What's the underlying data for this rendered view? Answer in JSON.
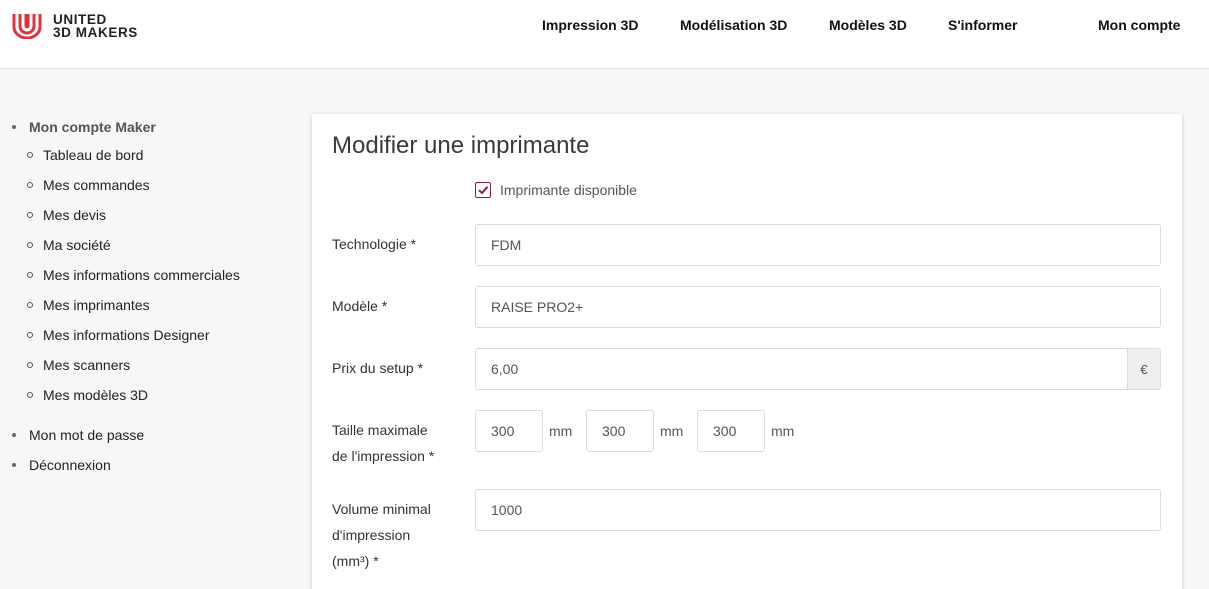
{
  "header": {
    "logo_line1": "UNITED",
    "logo_line2": "3D MAKERS",
    "brand_color": "#e2333d",
    "nav": {
      "impression": "Impression 3D",
      "modelisation": "Modélisation 3D",
      "modeles": "Modèles 3D",
      "informer": "S'informer",
      "compte": "Mon compte"
    }
  },
  "sidebar": {
    "maker": "Mon compte Maker",
    "items": [
      "Tableau de bord",
      "Mes commandes",
      "Mes devis",
      "Ma société",
      "Mes informations commerciales",
      "Mes imprimantes",
      "Mes informations Designer",
      "Mes scanners",
      "Mes modèles 3D"
    ],
    "password": "Mon mot de passe",
    "logout": "Déconnexion"
  },
  "form": {
    "title": "Modifier une imprimante",
    "available": {
      "label": "Imprimante disponible",
      "checked": true,
      "color": "#8a2238"
    },
    "technologie": {
      "label": "Technologie *",
      "value": "FDM"
    },
    "modele": {
      "label": "Modèle *",
      "value": "RAISE PRO2+"
    },
    "prix": {
      "label": "Prix du setup *",
      "value": "6,00",
      "addon": "€"
    },
    "taille": {
      "label_line1": "Taille maximale",
      "label_line2": "de l'impression *",
      "x": "300",
      "y": "300",
      "z": "300",
      "unit": "mm"
    },
    "volume": {
      "label_line1": "Volume minimal",
      "label_line2": "d'impression",
      "label_line3": "(mm³) *",
      "value": "1000"
    }
  }
}
